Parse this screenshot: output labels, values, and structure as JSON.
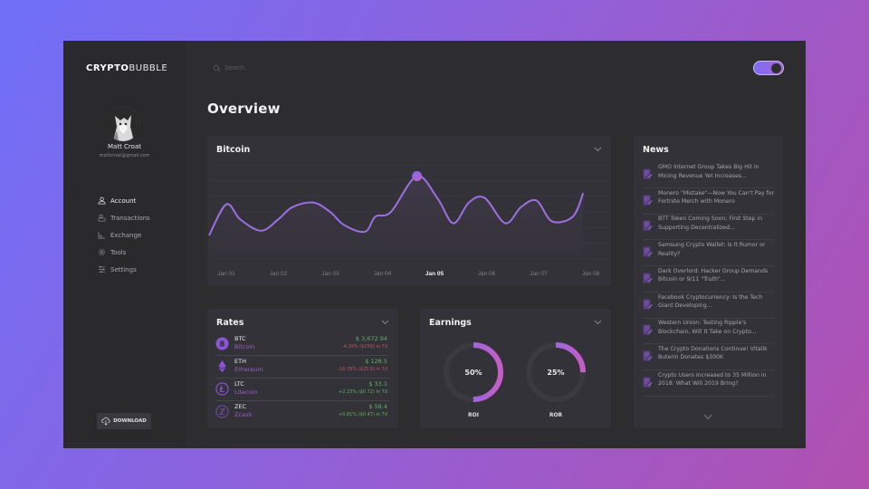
{
  "brand": {
    "bold": "CRYPTO",
    "light": "BUBBLE"
  },
  "user": {
    "name": "Matt Croat",
    "email": "mattcroat@gmail.com"
  },
  "sidebar": {
    "items": [
      {
        "label": "Account",
        "icon": "user-icon",
        "active": true
      },
      {
        "label": "Transactions",
        "icon": "transactions-icon",
        "active": false
      },
      {
        "label": "Exchange",
        "icon": "exchange-icon",
        "active": false
      },
      {
        "label": "Tools",
        "icon": "gear-icon",
        "active": false
      },
      {
        "label": "Settings",
        "icon": "sliders-icon",
        "active": false
      }
    ],
    "download_label": "DOWNLOAD"
  },
  "header": {
    "search_placeholder": "Search...",
    "theme_toggle_on": true
  },
  "page": {
    "title": "Overview"
  },
  "bitcoin": {
    "title": "Bitcoin",
    "selected_label": "Jan 05",
    "chart_data": {
      "type": "line",
      "title": "Bitcoin",
      "categories": [
        "Jan 01",
        "Jan 02",
        "Jan 03",
        "Jan 04",
        "Jan 05",
        "Jan 06",
        "Jan 07",
        "Jan 08"
      ],
      "x": [
        0,
        0.33,
        0.6,
        1.0,
        1.33,
        1.6,
        2.0,
        2.33,
        2.6,
        3.0,
        3.2,
        3.5,
        4.0,
        4.4,
        4.7,
        5.0,
        5.3,
        5.7,
        6.0,
        6.3,
        6.6,
        7.0,
        7.2
      ],
      "values": [
        25,
        58,
        42,
        30,
        42,
        55,
        60,
        50,
        36,
        29,
        45,
        50,
        88,
        64,
        38,
        60,
        65,
        38,
        55,
        62,
        40,
        45,
        70
      ],
      "highlight": {
        "x": 4.0,
        "value": 88,
        "label": "Jan 05"
      },
      "ylim": [
        0,
        100
      ],
      "grid": true,
      "xlabel": "",
      "ylabel": ""
    }
  },
  "rates": {
    "title": "Rates",
    "rows": [
      {
        "symbol": "BTC",
        "name": "Bitcoin",
        "price": "$ 3,672.94",
        "change": "-4.15% ($159) in 7d",
        "direction": "neg",
        "icon": "bitcoin-icon"
      },
      {
        "symbol": "ETH",
        "name": "Ethereum",
        "price": "$ 128.5",
        "change": "-16.78% ($25.9) in 7d",
        "direction": "neg",
        "icon": "ethereum-icon"
      },
      {
        "symbol": "LTC",
        "name": "Litecoin",
        "price": "$ 33.1",
        "change": "+2.23% ($0.72) in 7d",
        "direction": "pos",
        "icon": "litecoin-icon"
      },
      {
        "symbol": "ZEC",
        "name": "Zcash",
        "price": "$ 58.4",
        "change": "+0.81% ($0.47) in 7d",
        "direction": "pos",
        "icon": "zcash-icon"
      }
    ]
  },
  "earnings": {
    "title": "Earnings",
    "gauges": [
      {
        "label": "ROI",
        "percent": 50,
        "display": "50%"
      },
      {
        "label": "ROR",
        "percent": 25,
        "display": "25%"
      }
    ]
  },
  "news": {
    "title": "News",
    "items": [
      "GMO Internet Group Takes Big Hit in Mining Revenue Yet Increases...",
      "Monero \"Mistake\"—Now You Can't Pay for Fortnite Merch with Monero",
      "BTT Token Coming Soon; First Step in Supporting Decentralized...",
      "Samsung Crypto Wallet: Is It Rumor or Reality?",
      "Dark Overlord: Hacker Group Demands Bitcoin or 9/11 \"Truth\"...",
      "Facebook Cryptocurrency: Is the Tech Giant Developing...",
      "Western Union: Testing Ripple's Blockchain, Will It Take on Crypto...",
      "The Crypto Donations Continue! Vitalik Buterin Donates $300K",
      "Crypto Users Increased to 35 Million in 2018: What Will 2019 Bring?"
    ]
  },
  "colors": {
    "accent_start": "#7b6cf5",
    "accent_end": "#c45ec6",
    "line": "#9d6fe0",
    "positive": "#5fb35d",
    "negative": "#c0565b",
    "coin_name": "#9b5fc8"
  }
}
